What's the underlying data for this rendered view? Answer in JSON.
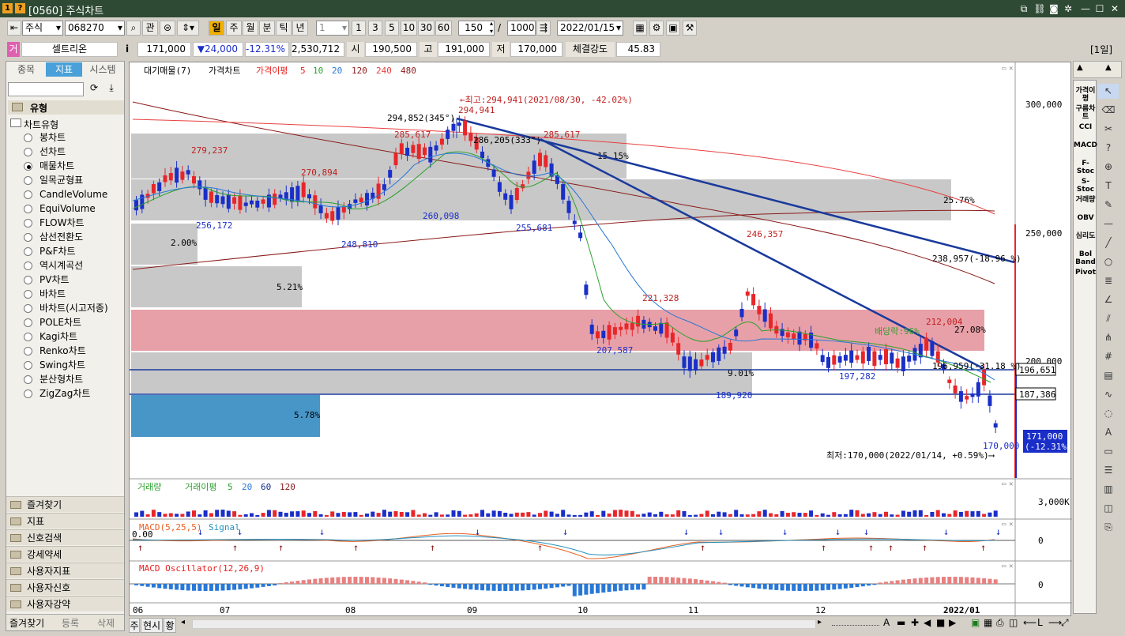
{
  "window": {
    "badge1": "1",
    "badge2": "?",
    "title": "[0560] 주식차트",
    "icons": [
      "new-window-icon",
      "link-icon",
      "camera-icon",
      "settings-icon",
      "minimize-icon",
      "maximize-icon",
      "close-icon"
    ]
  },
  "toolbar": {
    "market": "주식",
    "code": "068270",
    "btn_gwan": "관",
    "periods": [
      "일",
      "주",
      "월",
      "분",
      "틱",
      "년"
    ],
    "interval_value": "1",
    "quick_intervals": [
      "1",
      "3",
      "5",
      "10",
      "30",
      "60"
    ],
    "count": "150",
    "slash": "/",
    "total": "1000",
    "date": "2022/01/15"
  },
  "quote": {
    "name_prefix": "거",
    "name": "셀트리온",
    "info": "i",
    "price": "171,000",
    "change": "▼24,000",
    "change_pct": "-12.31%",
    "volume": "2,530,712",
    "open_label": "시",
    "open": "190,500",
    "high_label": "고",
    "high": "191,000",
    "low_label": "저",
    "low": "170,000",
    "strength_label": "체결강도",
    "strength": "45.83",
    "period_badge": "[1일]"
  },
  "left_panel": {
    "tabs": [
      "종목",
      "지표",
      "시스템"
    ],
    "active_tab": "지표",
    "section": "유형",
    "group": "차트유형",
    "chart_types": [
      "봉차트",
      "선차트",
      "매물차트",
      "일목균형표",
      "CandleVolume",
      "EquiVolume",
      "FLOW차트",
      "삼선전환도",
      "P&F차트",
      "역시계곡선",
      "PV차트",
      "바차트",
      "바차트(시고저종)",
      "POLE차트",
      "Kagi차트",
      "Renko차트",
      "Swing차트",
      "분산형차트",
      "ZigZag차트"
    ],
    "selected_type": "매물차트",
    "folders": [
      "즐겨찾기",
      "지표",
      "신호검색",
      "강세약세",
      "사용자지표",
      "사용자신호",
      "사용자강약"
    ],
    "bottom_tabs": [
      "즐겨찾기",
      "등록",
      "삭제"
    ]
  },
  "price_chart": {
    "legend": [
      "대기매물(7)",
      "가격차트",
      "가격이평",
      "5",
      "10",
      "20",
      "120",
      "240",
      "480"
    ],
    "y_ticks": [
      "300,000",
      "250,000",
      "200,000"
    ],
    "annotations": {
      "high_label": "←최고:294,941(2021/08/30, -42.02%)",
      "low_label": "최저:170,000(2022/01/14, +0.59%)⟶",
      "p294852": "294,852(345°)",
      "p294941": "294,941",
      "p285617a": "285,617",
      "p285617b": "285,617",
      "p279237": "279,237",
      "p270894": "270,894",
      "p286205": "286,205(333°)",
      "p260098": "260,098",
      "p256172": "256,172",
      "p255681": "255,681",
      "p248810": "248,810",
      "p246357": "246,357",
      "p221328": "221,328",
      "p207587": "207,587",
      "p212004": "212,004",
      "p197282": "197,282",
      "p189920": "189,920",
      "p170000": "170,000",
      "dividend": "배당락:96%",
      "tl1": "238,957(-18.96 %)",
      "tl2": "196,959(-31.18 %)",
      "line1": "196,651",
      "line2": "187,386",
      "last_price": "171,000",
      "last_pct": "(-12.31%)"
    },
    "volume_profile": [
      {
        "pct": "15.15%"
      },
      {
        "pct": "25.76%"
      },
      {
        "pct": "2.00%"
      },
      {
        "pct": "5.21%"
      },
      {
        "pct": "27.08%"
      },
      {
        "pct": "9.01%"
      },
      {
        "pct": "5.78%"
      }
    ]
  },
  "volume_chart": {
    "legend": [
      "거래량",
      "거래이평",
      "5",
      "20",
      "60",
      "120"
    ],
    "y_tick": "3,000K"
  },
  "macd_chart": {
    "legend": [
      "MACD(5,25,5)",
      "Signal"
    ],
    "left_tick": "0.00",
    "y_tick": "0"
  },
  "osc_chart": {
    "legend": [
      "MACD Oscillator(12,26,9)"
    ],
    "y_tick": "0"
  },
  "x_axis": [
    "06",
    "07",
    "08",
    "09",
    "10",
    "11",
    "12",
    "2022/01"
  ],
  "bottom_bar": {
    "tabs": [
      "주",
      "현시",
      "황"
    ]
  },
  "right_tools": [
    "가격이평",
    "구름차트",
    "CCI",
    "MACD",
    "F-Stoc",
    "S-Stoc",
    "거래량",
    "OBV",
    "심리도",
    "Bol Band",
    "Pivot"
  ],
  "colors": {
    "up": "#e8262a",
    "down": "#1a2ec8",
    "ma5": "#e82020",
    "ma10": "#2ca02c",
    "ma20": "#2878d8",
    "ma120": "#8b1a1a",
    "ma240": "#e84040",
    "profile_gray": "#c8c8c8",
    "profile_red": "#e8a0a8",
    "profile_blue": "#4896c8",
    "trend": "#1a3a9c",
    "title_bg": "#2e4a34"
  }
}
